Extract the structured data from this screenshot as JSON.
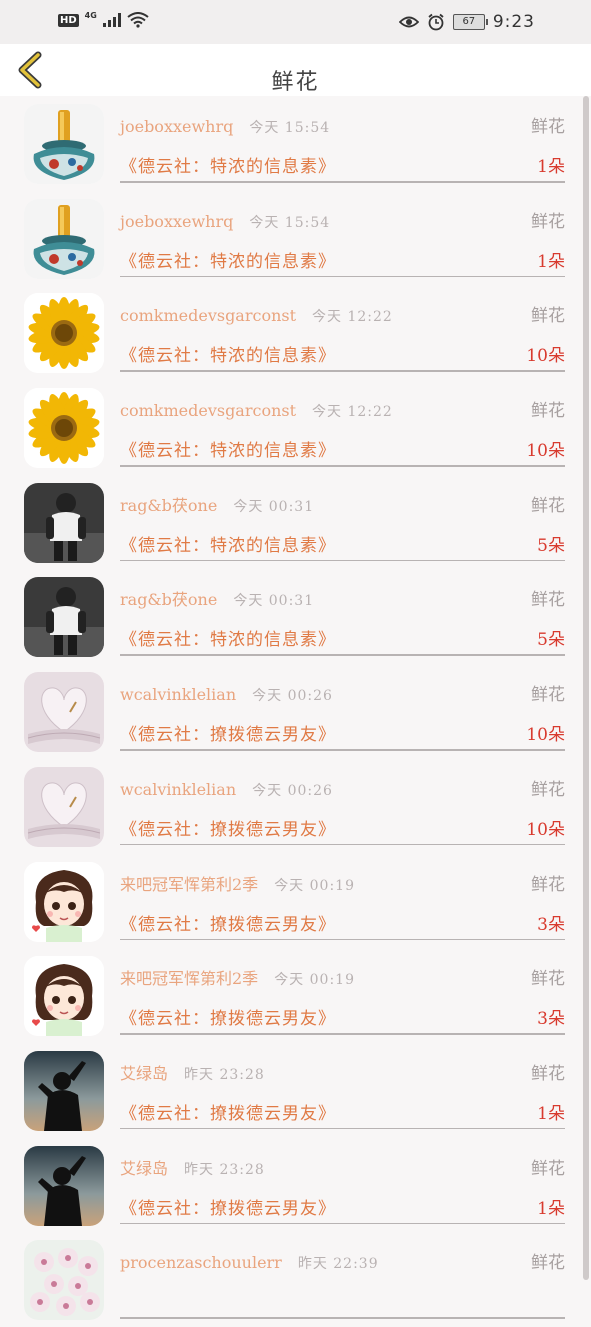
{
  "status_bar": {
    "hd": "HD",
    "network": "4G",
    "battery": "67",
    "time": "9:23"
  },
  "header": {
    "title": "鲜花"
  },
  "rows": [
    {
      "avatar": "vase",
      "name": "joeboxxewhrq",
      "time": "今天 15:54",
      "gift": "鲜花",
      "book": "《德云社：特浓的信息素》",
      "count": "1朵"
    },
    {
      "avatar": "vase",
      "name": "joeboxxewhrq",
      "time": "今天 15:54",
      "gift": "鲜花",
      "book": "《德云社：特浓的信息素》",
      "count": "1朵"
    },
    {
      "avatar": "sunflower",
      "name": "comkmedevsgarconst",
      "time": "今天 12:22",
      "gift": "鲜花",
      "book": "《德云社：特浓的信息素》",
      "count": "10朵"
    },
    {
      "avatar": "sunflower",
      "name": "comkmedevsgarconst",
      "time": "今天 12:22",
      "gift": "鲜花",
      "book": "《德云社：特浓的信息素》",
      "count": "10朵"
    },
    {
      "avatar": "boy",
      "name": "rag&b茯one",
      "time": "今天 00:31",
      "gift": "鲜花",
      "book": "《德云社：特浓的信息素》",
      "count": "5朵"
    },
    {
      "avatar": "boy",
      "name": "rag&b茯one",
      "time": "今天 00:31",
      "gift": "鲜花",
      "book": "《德云社：特浓的信息素》",
      "count": "5朵"
    },
    {
      "avatar": "heart-book",
      "name": "wcalvinklelian",
      "time": "今天 00:26",
      "gift": "鲜花",
      "book": "《德云社：撩拨德云男友》",
      "count": "10朵"
    },
    {
      "avatar": "heart-book",
      "name": "wcalvinklelian",
      "time": "今天 00:26",
      "gift": "鲜花",
      "book": "《德云社：撩拨德云男友》",
      "count": "10朵"
    },
    {
      "avatar": "anime-girl",
      "name": "来吧冠军恽第利2季",
      "time": "今天 00:19",
      "gift": "鲜花",
      "book": "《德云社：撩拨德云男友》",
      "count": "3朵"
    },
    {
      "avatar": "anime-girl",
      "name": "来吧冠军恽第利2季",
      "time": "今天 00:19",
      "gift": "鲜花",
      "book": "《德云社：撩拨德云男友》",
      "count": "3朵"
    },
    {
      "avatar": "silhouette",
      "name": "艾绿岛",
      "time": "昨天 23:28",
      "gift": "鲜花",
      "book": "《德云社：撩拨德云男友》",
      "count": "1朵"
    },
    {
      "avatar": "silhouette",
      "name": "艾绿岛",
      "time": "昨天 23:28",
      "gift": "鲜花",
      "book": "《德云社：撩拨德云男友》",
      "count": "1朵"
    },
    {
      "avatar": "flowers",
      "name": "procenzaschouulerr",
      "time": "昨天 22:39",
      "gift": "鲜花",
      "book": "",
      "count": ""
    }
  ],
  "colors": {
    "accent_name": "#e9a47e",
    "book": "#e07a45",
    "count": "#d83a2e",
    "back_icon": "#d6b229"
  }
}
